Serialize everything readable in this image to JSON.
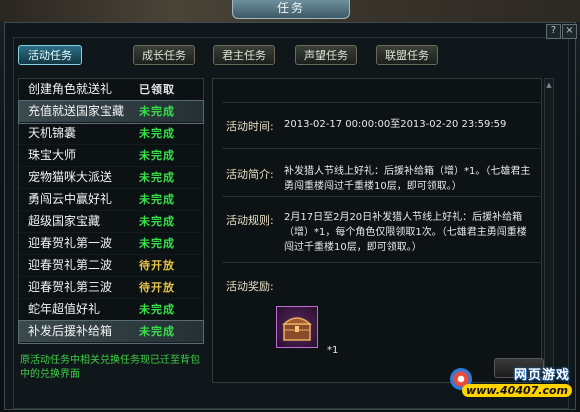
{
  "window": {
    "title": "任务",
    "help": "?",
    "close": "×"
  },
  "tabs": [
    {
      "label": "活动任务",
      "active": true
    },
    {
      "label": "成长任务"
    },
    {
      "label": "君主任务"
    },
    {
      "label": "声望任务"
    },
    {
      "label": "联盟任务"
    }
  ],
  "tasks": [
    {
      "name": "创建角色就送礼",
      "status": "已领取",
      "kind": "done"
    },
    {
      "name": "充值就送国家宝藏",
      "status": "未完成",
      "kind": "green",
      "selected": false
    },
    {
      "name": "天机锦囊",
      "status": "未完成",
      "kind": "green"
    },
    {
      "name": "珠宝大师",
      "status": "未完成",
      "kind": "green"
    },
    {
      "name": "宠物猫咪大派送",
      "status": "未完成",
      "kind": "green"
    },
    {
      "name": "勇闯云中赢好礼",
      "status": "未完成",
      "kind": "green"
    },
    {
      "name": "超级国家宝藏",
      "status": "未完成",
      "kind": "green"
    },
    {
      "name": "迎春贺礼第一波",
      "status": "未完成",
      "kind": "green"
    },
    {
      "name": "迎春贺礼第二波",
      "status": "待开放",
      "kind": "yellow"
    },
    {
      "name": "迎春贺礼第三波",
      "status": "待开放",
      "kind": "yellow"
    },
    {
      "name": "蛇年超值好礼",
      "status": "未完成",
      "kind": "green"
    },
    {
      "name": "补发后援补给箱",
      "status": "未完成",
      "kind": "green",
      "selected": true
    }
  ],
  "note": "原活动任务中相关兑换任务现已迁至背包中的兑换界面",
  "detail": {
    "time_label": "活动时间:",
    "time_value": "2013-02-17 00:00:00至2013-02-20 23:59:59",
    "intro_label": "活动简介:",
    "intro_value": "补发猎人节线上好礼：后援补给箱（增）*1。（七雄君主勇闯重楼闯过千重楼10层，即可领取。）",
    "rules_label": "活动规则:",
    "rules_value": "2月17日至2月20日补发猎人节线上好礼：后援补给箱（增）*1，每个角色仅限领取1次。（七雄君主勇闯重楼闯过千重楼10层，即可领取。）",
    "reward_label": "活动奖励:",
    "reward_count": "*1",
    "reward_icon": "treasure-chest-icon"
  },
  "watermark": {
    "top": "网页游戏",
    "bottom": "www.40407.com"
  }
}
